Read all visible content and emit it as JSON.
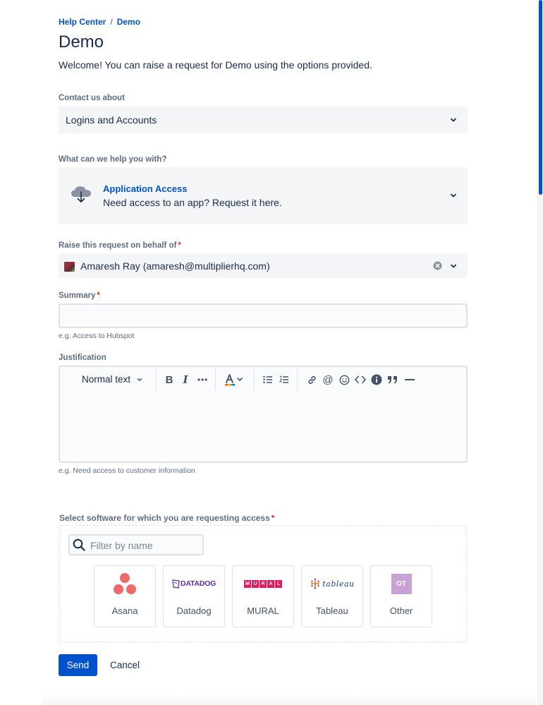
{
  "breadcrumb": {
    "home": "Help Center",
    "separator": "/",
    "current": "Demo"
  },
  "page": {
    "title": "Demo",
    "welcome": "Welcome! You can raise a request for Demo using the options provided."
  },
  "contact": {
    "label": "Contact us about",
    "value": "Logins and Accounts"
  },
  "help": {
    "label": "What can we help you with?",
    "title": "Application Access",
    "description": "Need access to an app? Request it here.",
    "icon": "cloud-download-icon"
  },
  "behalf": {
    "label": "Raise this request on behalf of",
    "required_mark": "*",
    "value": "Amaresh Ray (amaresh@multiplierhq.com)"
  },
  "summary": {
    "label": "Summary",
    "required_mark": "*",
    "value": "",
    "hint": "e.g. Access to Hubspot"
  },
  "justification": {
    "label": "Justification",
    "hint": "e.g. Need access to customer information",
    "toolbar": {
      "text_style": "Normal text"
    }
  },
  "software": {
    "label": "Select software for which you are requesting access",
    "required_mark": "*",
    "filter_placeholder": "Filter by name",
    "items": [
      {
        "name": "Asana"
      },
      {
        "name": "Datadog",
        "logo_text": "DATADOG"
      },
      {
        "name": "MURAL",
        "logo_letters": [
          "M",
          "U",
          "R",
          "A",
          "L"
        ]
      },
      {
        "name": "Tableau",
        "logo_text": "tableau"
      },
      {
        "name": "Other",
        "logo_text": "OT"
      }
    ]
  },
  "actions": {
    "send": "Send",
    "cancel": "Cancel"
  },
  "colors": {
    "accent": "#0052cc",
    "required": "#de350b",
    "field_bg": "#f4f5f7",
    "asana": "#f06a6a",
    "datadog": "#632ca6",
    "mural": "#e8175d",
    "other_tile": "#c8a2d4"
  }
}
